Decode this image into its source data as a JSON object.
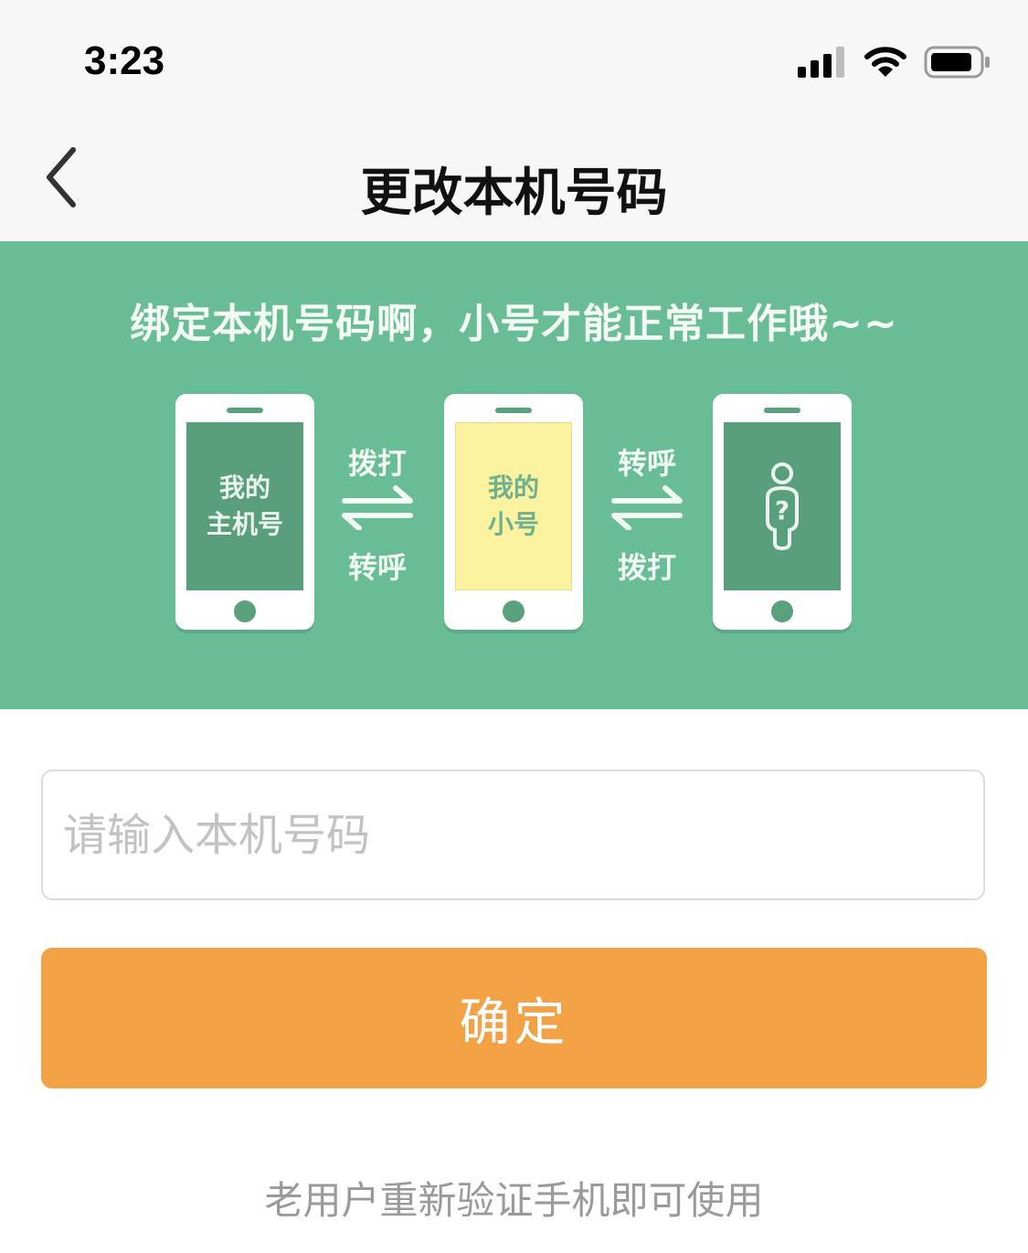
{
  "status_bar": {
    "time": "3:23",
    "signal_icon": "cellular-signal-icon",
    "wifi_icon": "wifi-icon",
    "battery_icon": "battery-icon"
  },
  "nav": {
    "back_icon": "chevron-left-icon",
    "title": "更改本机号码"
  },
  "banner": {
    "headline": "绑定本机号码啊，小号才能正常工作哦~~",
    "background_color": "#68bd97",
    "phones": [
      {
        "label_line1": "我的",
        "label_line2": "主机号"
      },
      {
        "label_line1": "我的",
        "label_line2": "小号"
      },
      {
        "icon": "unknown-person-icon",
        "label": "?"
      }
    ],
    "arrows": [
      {
        "top_label": "拨打",
        "bottom_label": "转呼"
      },
      {
        "top_label": "转呼",
        "bottom_label": "拨打"
      }
    ]
  },
  "form": {
    "phone_input_placeholder": "请输入本机号码",
    "phone_input_value": "",
    "confirm_label": "确定",
    "confirm_color": "#f2a245"
  },
  "footer": {
    "reverify_link": "老用户重新验证手机即可使用"
  }
}
